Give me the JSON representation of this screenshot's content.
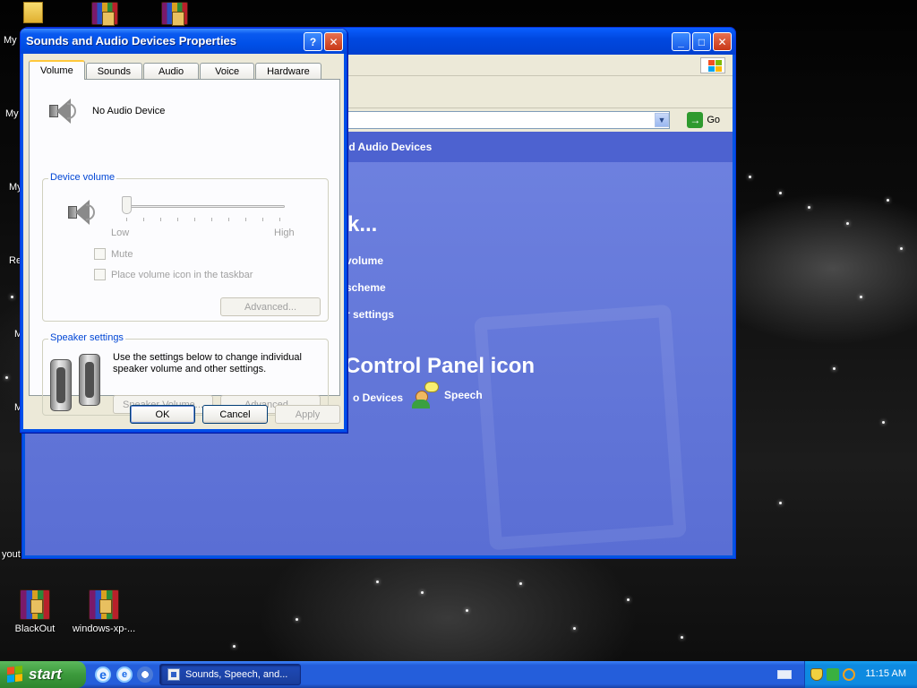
{
  "desktop": {
    "icons": [
      {
        "label": "BlackOut"
      },
      {
        "label": "windows-xp-..."
      }
    ],
    "edge_labels": [
      "My",
      "My",
      "My",
      "Re",
      "M",
      "M",
      "yout"
    ]
  },
  "control_panel": {
    "go_label": "Go",
    "header": "nd Audio Devices",
    "pick_task": "k...",
    "tasks": [
      "volume",
      "scheme",
      "r settings"
    ],
    "or_pick": "Control Panel icon",
    "items": [
      "o Devices",
      "Speech"
    ]
  },
  "dialog": {
    "title": "Sounds and Audio Devices Properties",
    "help_label": "?",
    "close_label": "✕",
    "tabs": [
      "Volume",
      "Sounds",
      "Audio",
      "Voice",
      "Hardware"
    ],
    "active_tab": "Volume",
    "device_name": "No Audio Device",
    "device_volume": {
      "label": "Device volume",
      "low_label": "Low",
      "high_label": "High",
      "level": 0,
      "mute_label": "Mute",
      "taskbar_label": "Place volume icon in the taskbar",
      "advanced_label": "Advanced..."
    },
    "speaker_settings": {
      "label": "Speaker settings",
      "description": "Use the settings below to change individual speaker volume and other settings.",
      "speaker_volume_label": "Speaker Volume...",
      "advanced_label": "Advanced..."
    },
    "buttons": {
      "ok": "OK",
      "cancel": "Cancel",
      "apply": "Apply"
    }
  },
  "taskbar": {
    "start_label": "start",
    "task_label": "Sounds, Speech, and...",
    "clock": "11:15 AM"
  },
  "colors": {
    "xp_blue": "#0054e3",
    "control_panel_bg": "#6276d8",
    "dialog_face": "#ece9d8",
    "group_label": "#0046d5",
    "start_green": "#3c9a3c"
  }
}
